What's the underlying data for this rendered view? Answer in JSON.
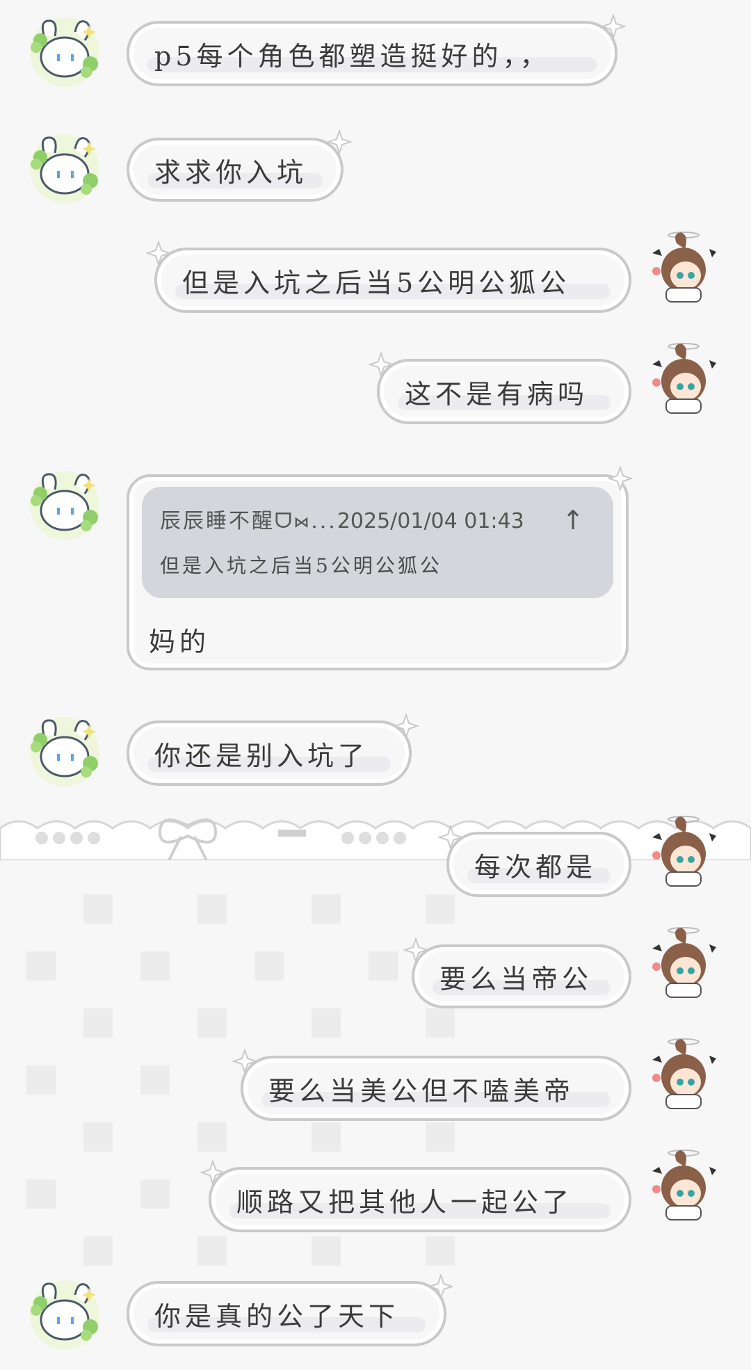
{
  "chat": {
    "messages": [
      {
        "side": "left",
        "text": "p5每个角色都塑造挺好的，，"
      },
      {
        "side": "left",
        "text": "求求你入坑"
      },
      {
        "side": "right",
        "text": "但是入坑之后当5公明公狐公"
      },
      {
        "side": "right",
        "text": "这不是有病吗"
      },
      {
        "side": "left",
        "quote": {
          "sender": "辰辰睡不醒ᗜ⋈...",
          "timestamp": "2025/01/04 01:43",
          "arrow": "↑",
          "text": "但是入坑之后当5公明公狐公"
        },
        "text": "妈的"
      },
      {
        "side": "left",
        "text": "你还是别入坑了"
      },
      {
        "side": "right",
        "text": "每次都是"
      },
      {
        "side": "right",
        "text": "要么当帝公"
      },
      {
        "side": "right",
        "text": "要么当美公但不嗑美帝"
      },
      {
        "side": "right",
        "text": "顺路又把其他人一起公了"
      },
      {
        "side": "left",
        "text": "你是真的公了天下"
      }
    ]
  },
  "theme": {
    "bubble_border": "#c9c9c9",
    "bubble_fill": "#f7f7f7",
    "quote_fill": "#d5d6dc",
    "avatar_left_icon": "bunny-clover-avatar",
    "avatar_right_icon": "brown-hair-girl-avatar"
  }
}
